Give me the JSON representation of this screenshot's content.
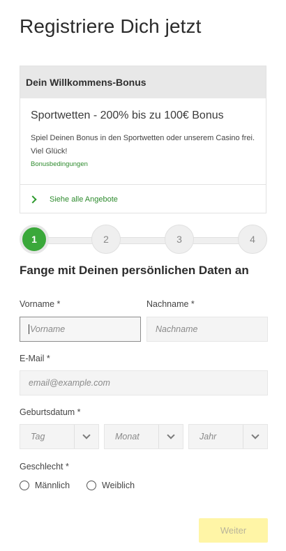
{
  "page": {
    "title": "Registriere Dich jetzt"
  },
  "bonus": {
    "header": "Dein Willkommens-Bonus",
    "offer": "Sportwetten - 200% bis zu 100€ Bonus",
    "description": "Spiel Deinen Bonus in den Sportwetten oder unserem Casino frei. Viel Glück!",
    "terms_link": "Bonusbedingungen",
    "all_offers_link": "Siehe alle Angebote"
  },
  "steps": {
    "items": [
      "1",
      "2",
      "3",
      "4"
    ],
    "active": 1
  },
  "form": {
    "section_title": "Fange mit Deinen persönlichen Daten an",
    "firstname": {
      "label": "Vorname *",
      "placeholder": "Vorname",
      "value": ""
    },
    "lastname": {
      "label": "Nachname *",
      "placeholder": "Nachname",
      "value": ""
    },
    "email": {
      "label": "E-Mail *",
      "placeholder": "email@example.com",
      "value": ""
    },
    "birthdate": {
      "label": "Geburtsdatum *",
      "day": "Tag",
      "month": "Monat",
      "year": "Jahr"
    },
    "gender": {
      "label": "Geschlecht *",
      "options": [
        "Männlich",
        "Weiblich"
      ]
    },
    "next_button": "Weiter"
  },
  "colors": {
    "accent_green": "#3aa83a",
    "link_green": "#2e8b2e",
    "button_disabled": "#fff5a6"
  }
}
